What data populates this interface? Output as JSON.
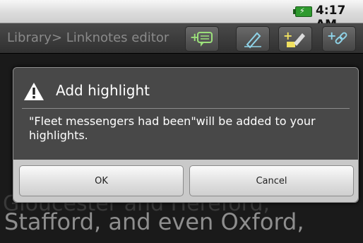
{
  "status": {
    "time": "4:17 AM",
    "battery_icon": "battery-charging-icon"
  },
  "titlebar": {
    "title": "Library> Linknotes editor",
    "actions": [
      {
        "name": "add-note-icon"
      },
      {
        "name": "link-edit-icon"
      },
      {
        "name": "add-highlight-icon"
      },
      {
        "name": "add-link-icon"
      }
    ]
  },
  "content": {
    "partial_line": "Gloucester and Hereford,",
    "line": "Stafford, and even Oxford,"
  },
  "dialog": {
    "title": "Add highlight",
    "message": "\"Fleet messengers had been\"will be added to your highlights.",
    "ok_label": "OK",
    "cancel_label": "Cancel"
  },
  "colors": {
    "accent_green": "#2e9a2e",
    "dialog_bg": "#484848",
    "button_bg": "#dedede"
  }
}
